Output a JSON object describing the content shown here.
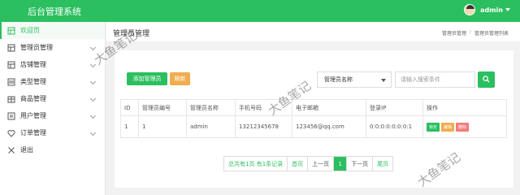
{
  "header": {
    "title": "后台管理系统",
    "user": "admin"
  },
  "sidebar": {
    "items": [
      {
        "label": "欢迎页",
        "icon": "home-icon",
        "active": true,
        "expandable": false
      },
      {
        "label": "管理员管理",
        "icon": "table-icon",
        "active": false,
        "expandable": true
      },
      {
        "label": "店铺管理",
        "icon": "store-icon",
        "active": false,
        "expandable": true
      },
      {
        "label": "类型管理",
        "icon": "list-icon",
        "active": false,
        "expandable": true
      },
      {
        "label": "商品管理",
        "icon": "goods-icon",
        "active": false,
        "expandable": true
      },
      {
        "label": "用户管理",
        "icon": "user-icon",
        "active": false,
        "expandable": true
      },
      {
        "label": "订单管理",
        "icon": "heart-icon",
        "active": false,
        "expandable": true
      },
      {
        "label": "退出",
        "icon": "close-icon",
        "active": false,
        "expandable": false
      }
    ]
  },
  "page": {
    "title": "管理员管理",
    "breadcrumb": [
      "管理员管理",
      "管理员管理列表"
    ]
  },
  "toolbar": {
    "add_label": "添加管理员",
    "refresh_label": "刷新"
  },
  "search": {
    "field_selected": "管理员名称",
    "placeholder": "请输入搜索条件"
  },
  "table": {
    "headers": [
      "ID",
      "管理员编号",
      "管理员名称",
      "手机号码",
      "电子邮箱",
      "登录IP",
      "操作"
    ],
    "rows": [
      {
        "id": "1",
        "code": "1",
        "name": "admin",
        "phone": "13212345678",
        "email": "123456@qq.com",
        "ip": "0:0:0:0:0:0:0:1",
        "actions": [
          "锁定",
          "编辑",
          "删除"
        ]
      }
    ]
  },
  "pagination": {
    "summary1": "总共有1页",
    "summary2": "有1条记录",
    "first": "首页",
    "prev": "上一页",
    "current": "1",
    "next": "下一页",
    "last": "尾页"
  },
  "watermark": "大鱼笔记",
  "colors": {
    "primary": "#2bbf5f",
    "warning": "#f0ad4e",
    "danger": "#f37b7b"
  }
}
